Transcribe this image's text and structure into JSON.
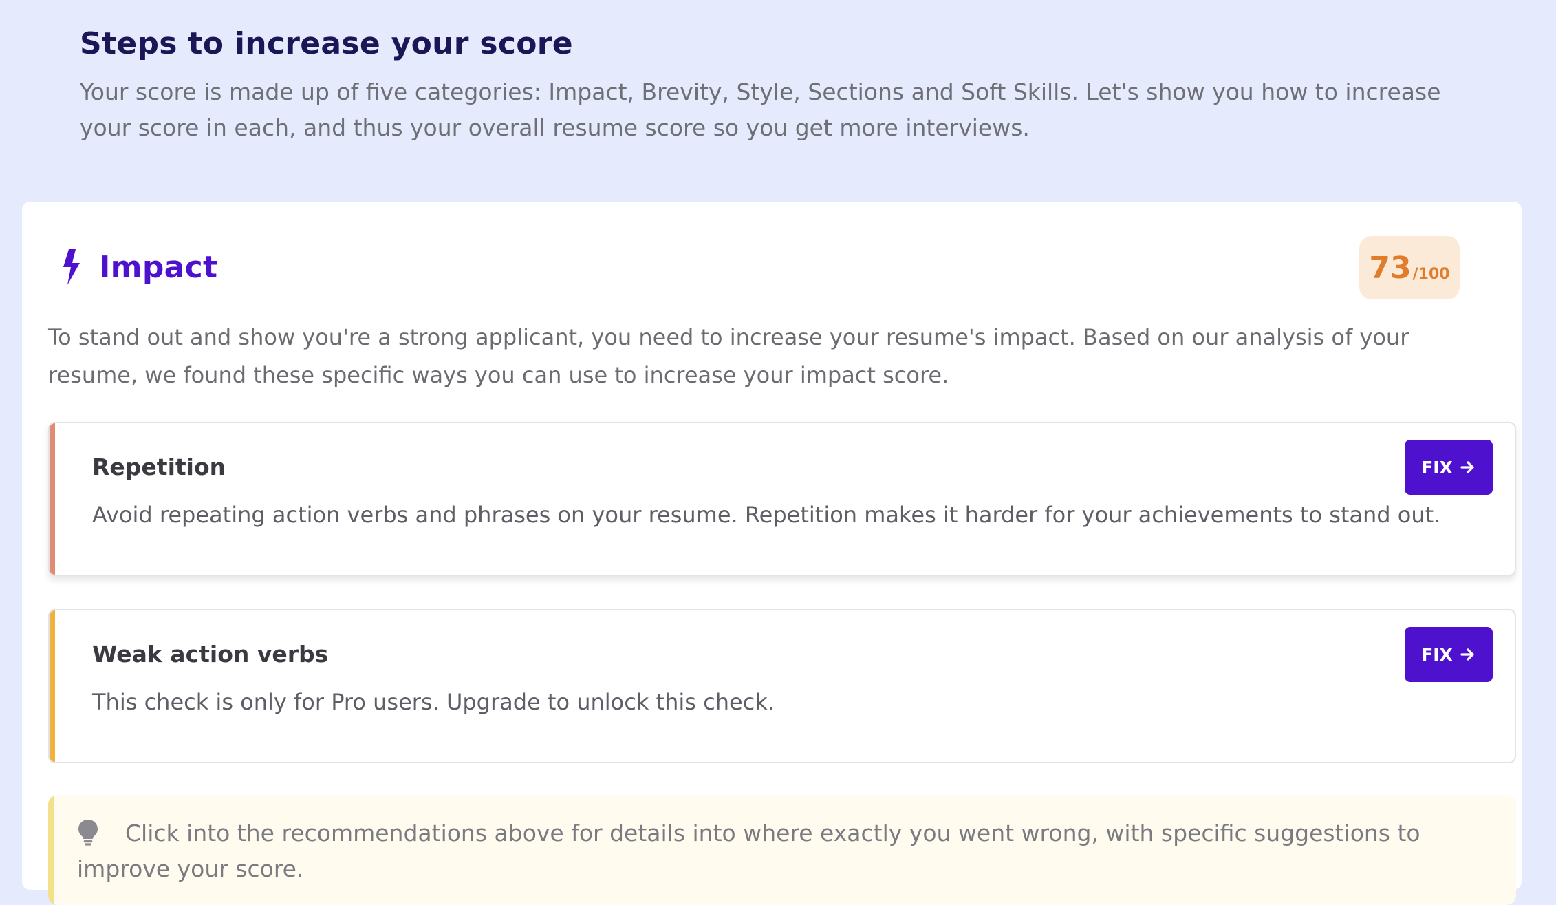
{
  "intro": {
    "title": "Steps to increase your score",
    "text": "Your score is made up of five categories: Impact, Brevity, Style, Sections and Soft Skills. Let's show you how to increase your score in each, and thus your overall resume score so you get more interviews."
  },
  "category": {
    "icon": "lightning-bolt-icon",
    "title": "Impact",
    "score": "73",
    "score_max": "/100",
    "description": "To stand out and show you're a strong applicant, you need to increase your resume's impact. Based on our analysis of your resume, we found these specific ways you can use to increase your impact score."
  },
  "checks": [
    {
      "title": "Repetition",
      "text": "Avoid repeating action verbs and phrases on your resume. Repetition makes it harder for your achievements to stand out.",
      "button": "FIX",
      "accent": "#e08c74"
    },
    {
      "title": "Weak action verbs",
      "text": "This check is only for Pro users. Upgrade to unlock this check.",
      "button": "FIX",
      "accent": "#efb33c"
    }
  ],
  "tip": {
    "icon": "lightbulb-icon",
    "text": "Click into the recommendations above for details into where exactly you went wrong, with specific suggestions to improve your score."
  },
  "colors": {
    "brand": "#4e12cf",
    "score": "#e07d2c",
    "background": "#e6eafd"
  }
}
